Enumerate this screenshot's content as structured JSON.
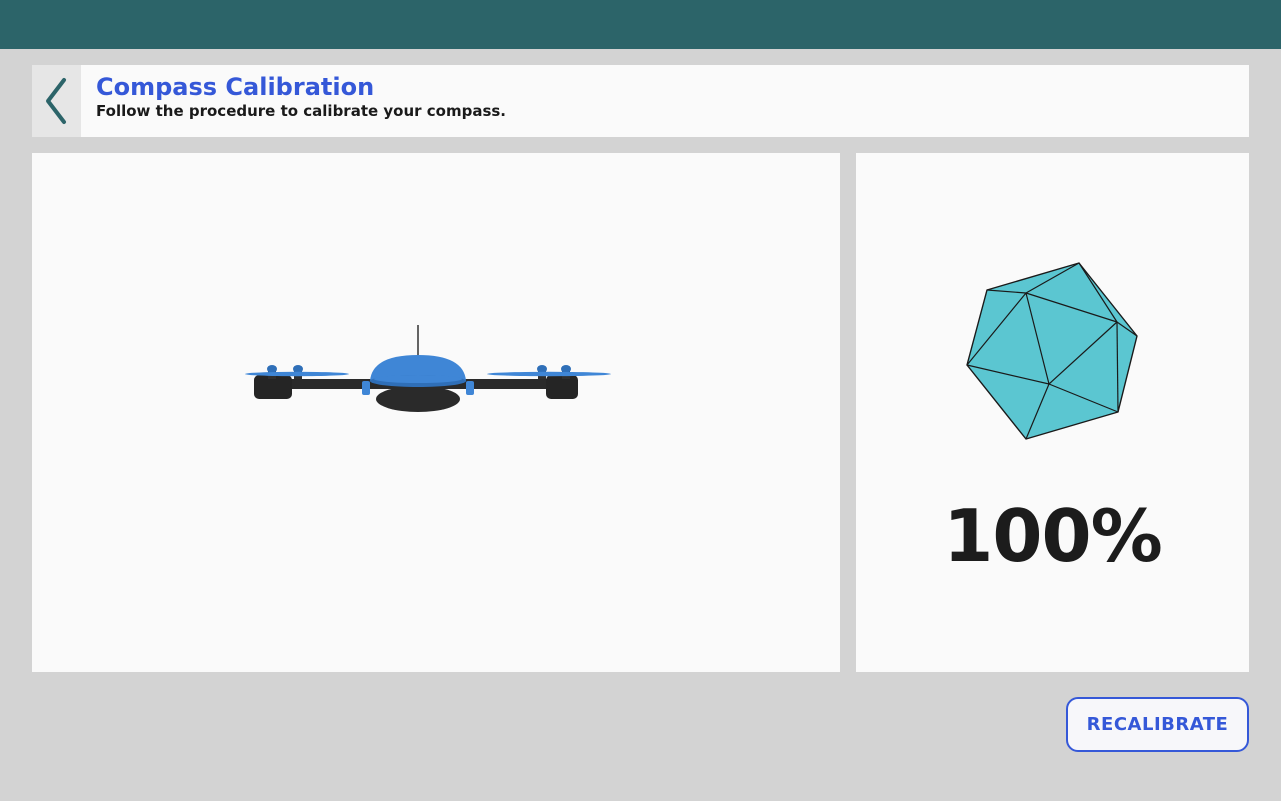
{
  "header": {
    "title": "Compass Calibration",
    "subtitle": "Follow the procedure to calibrate your compass."
  },
  "icons": {
    "back": "chevron-left-icon",
    "drone": "drone-illustration",
    "calibration_shape": "icosahedron-icon"
  },
  "calibration": {
    "progress": 1.0,
    "progress_label": "100%"
  },
  "actions": {
    "recalibrate_label": "RECALIBRATE"
  },
  "colors": {
    "topbar": "#2c6469",
    "accent": "#3558d8",
    "shape_fill": "#5bc6d1",
    "drone_blue": "#3f86d6"
  }
}
